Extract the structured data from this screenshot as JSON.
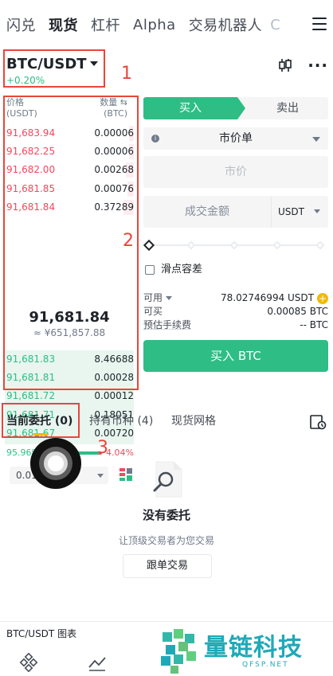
{
  "nav": {
    "tabs": [
      "闪兑",
      "现货",
      "杠杆",
      "Alpha",
      "交易机器人",
      "C"
    ],
    "active": "现货"
  },
  "pair": {
    "name": "BTC/USDT",
    "change": "+0.20%"
  },
  "annotations": [
    "1",
    "2",
    "3"
  ],
  "colors": {
    "buy": "#2ebd85",
    "sell": "#f6465d",
    "accent": "#f0b90b",
    "annotation": "#e9463a"
  },
  "orderbook": {
    "price_header": "价格",
    "price_unit": "(USDT)",
    "qty_header": "数量 ⇆",
    "qty_unit": "(BTC)",
    "asks": [
      {
        "price": "91,683.94",
        "qty": "0.00006",
        "depth": 0.04
      },
      {
        "price": "91,682.25",
        "qty": "0.00006",
        "depth": 0.04
      },
      {
        "price": "91,682.00",
        "qty": "0.00268",
        "depth": 0.06
      },
      {
        "price": "91,681.85",
        "qty": "0.00076",
        "depth": 0.05
      },
      {
        "price": "91,681.84",
        "qty": "0.37289",
        "depth": 0.08
      }
    ],
    "last_price": "91,681.84",
    "fiat_price": "≈ ¥651,857.88",
    "bids": [
      {
        "price": "91,681.83",
        "qty": "8.46688"
      },
      {
        "price": "91,681.81",
        "qty": "0.00028"
      },
      {
        "price": "91,681.72",
        "qty": "0.00012"
      },
      {
        "price": "91,681.71",
        "qty": "0.18051"
      },
      {
        "price": "91,681.67",
        "qty": "0.00720"
      }
    ],
    "buy_ratio_label": "95.96%",
    "sell_ratio_label": "4.04%",
    "buy_ratio": 0.9596,
    "depth_step": "0.01"
  },
  "form": {
    "buy_tab": "买入",
    "sell_tab": "卖出",
    "order_type": "市价单",
    "price_placeholder": "市价",
    "amount_placeholder": "成交金额",
    "amount_unit": "USDT",
    "slippage_label": "滑点容差",
    "available_label": "可用",
    "available_value": "78.02746994 USDT",
    "can_buy_label": "可买",
    "can_buy_value": "0.00085 BTC",
    "fee_label": "预估手续费",
    "fee_value": "-- BTC",
    "submit": "买入 BTC"
  },
  "orders": {
    "tabs": [
      "当前委托 (0)",
      "持有币种 (4)",
      "现货网格"
    ],
    "empty_title": "没有委托",
    "empty_subtitle": "让顶级交易者为您交易",
    "copy_button": "跟单交易"
  },
  "chart_bar": {
    "label": "BTC/USDT 图表"
  },
  "watermark": {
    "title": "量链科技",
    "subtitle": "QFSP.NET"
  }
}
